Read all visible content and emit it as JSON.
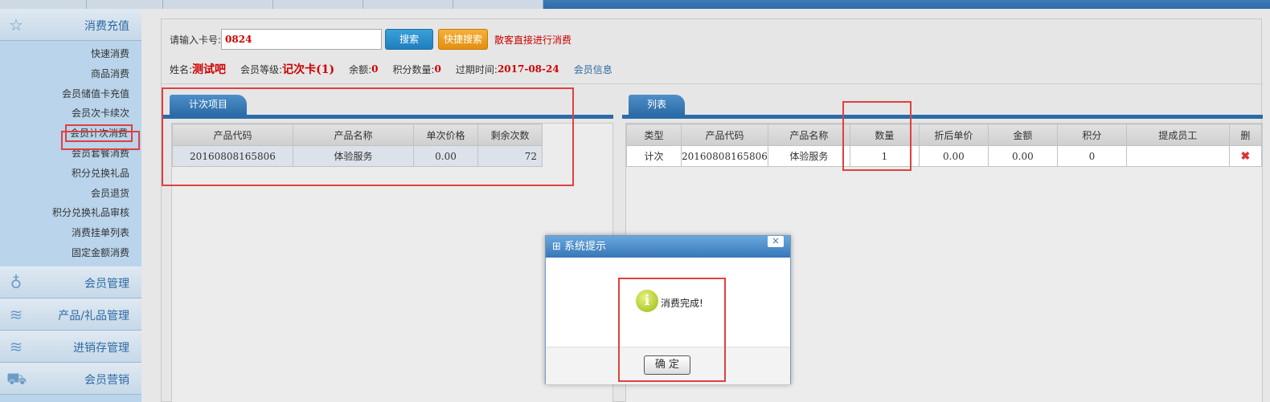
{
  "sidebar": {
    "top_section": {
      "label": "消费充值",
      "icon": "star-icon"
    },
    "items": [
      {
        "label": "快速消费"
      },
      {
        "label": "商品消费"
      },
      {
        "label": "会员储值卡充值"
      },
      {
        "label": "会员次卡续次"
      },
      {
        "label": "会员计次消费",
        "active": true
      },
      {
        "label": "会员套餐消费"
      },
      {
        "label": "积分兑换礼品"
      },
      {
        "label": "会员退货"
      },
      {
        "label": "积分兑换礼品审核"
      },
      {
        "label": "消费挂单列表"
      },
      {
        "label": "固定金额消费"
      }
    ],
    "sections": [
      {
        "label": "会员管理",
        "icon": "user-icon"
      },
      {
        "label": "产品/礼品管理",
        "icon": "layers-icon"
      },
      {
        "label": "进销存管理",
        "icon": "layers-icon"
      },
      {
        "label": "会员营销",
        "icon": "car-icon"
      }
    ]
  },
  "search": {
    "label": "请输入卡号:",
    "value": "0824",
    "search_btn": "搜索",
    "quick_btn": "快捷搜索",
    "hint": "散客直接进行消费"
  },
  "member": {
    "name_label": "姓名:",
    "name": "测试吧",
    "level_label": "会员等级:",
    "level": "记次卡(1)",
    "balance_label": "余额:",
    "balance": "0",
    "points_label": "积分数量:",
    "points": "0",
    "expire_label": "过期时间:",
    "expire": "2017-08-24",
    "info_link": "会员信息"
  },
  "left_panel": {
    "tab": "计次项目",
    "headers": [
      "产品代码",
      "产品名称",
      "单次价格",
      "剩余次数"
    ],
    "rows": [
      [
        "20160808165806",
        "体验服务",
        "0.00",
        "72"
      ]
    ]
  },
  "right_panel": {
    "tab": "列表",
    "headers": [
      "类型",
      "产品代码",
      "产品名称",
      "数量",
      "折后单价",
      "金额",
      "积分",
      "提成员工",
      "删"
    ],
    "rows": [
      [
        "计次",
        "20160808165806",
        "体验服务",
        "1",
        "0.00",
        "0.00",
        "0",
        "",
        "✖"
      ]
    ]
  },
  "dialog": {
    "title": "系统提示",
    "close": "×",
    "message": "消费完成!",
    "ok": "确 定"
  },
  "colors": {
    "accent": "#2b6ca8",
    "alert": "#cc0000",
    "annotation": "#e04040"
  }
}
